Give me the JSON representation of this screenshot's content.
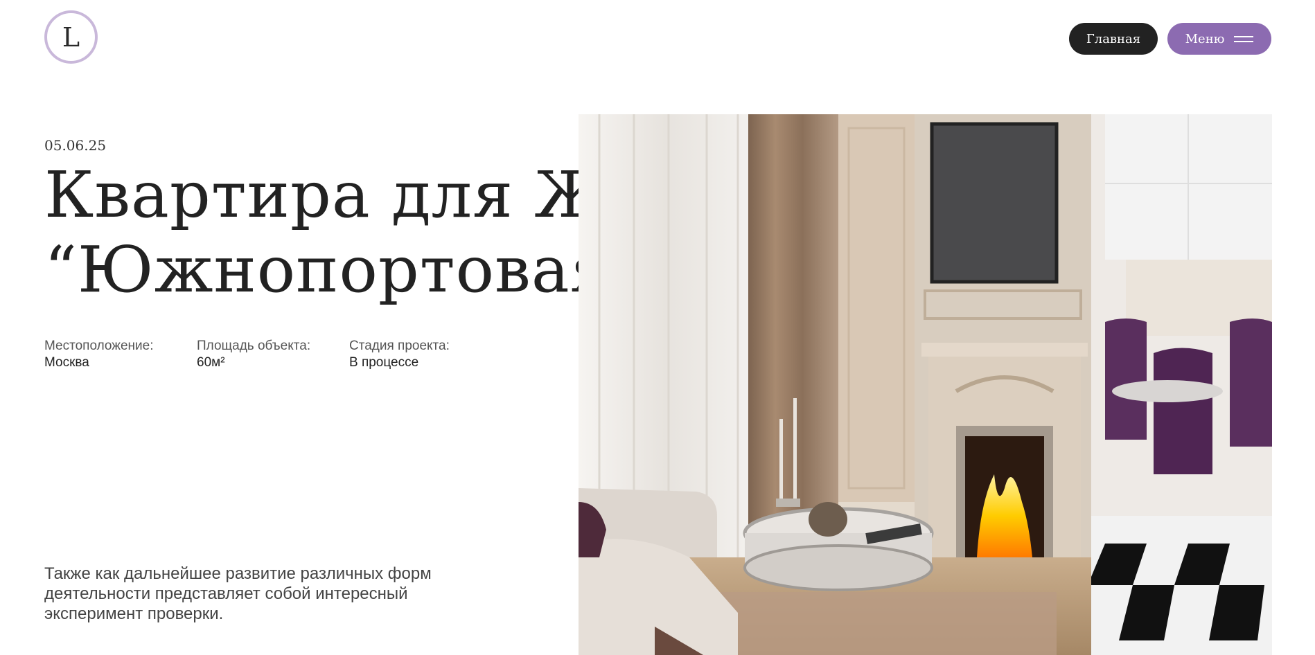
{
  "header": {
    "logo_letter": "L",
    "home_label": "Главная",
    "menu_label": "Меню"
  },
  "project": {
    "date": "05.06.25",
    "title_line1": "Квартира для ЖК",
    "title_line2": "“Южнопортовая”",
    "meta": [
      {
        "label": "Местоположение:",
        "value": "Москва"
      },
      {
        "label": "Площадь объекта:",
        "value": "60м²"
      },
      {
        "label": "Стадия проекта:",
        "value": "В процессе"
      }
    ],
    "description": "Также как дальнейшее развитие различных форм деятельности представляет собой интересный эксперимент проверки."
  },
  "colors": {
    "accent": "#8c6bb1",
    "dark": "#222222",
    "logo_ring": "#c9b8da"
  }
}
